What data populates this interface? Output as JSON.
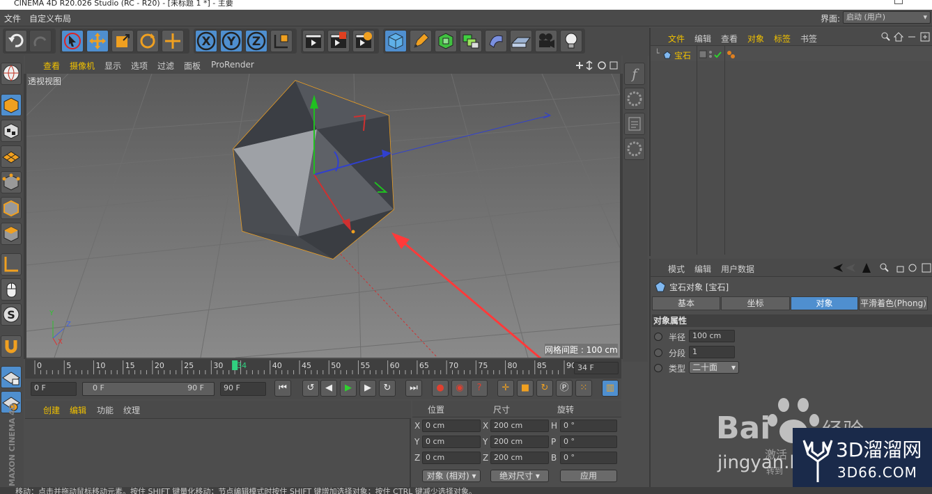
{
  "window": {
    "title": "CINEMA 4D R20.026 Studio (RC - R20) - [未标题 1 *] - 主要"
  },
  "menubar": {
    "items": [
      "文件",
      "自定义布局"
    ],
    "layout_label": "界面:",
    "layout_value": "启动 (用户)"
  },
  "viewport": {
    "menu": [
      "查看",
      "摄像机",
      "显示",
      "选项",
      "过滤",
      "面板",
      "ProRender"
    ],
    "view_name": "透视视图",
    "grid_spacing": "网格间距 : 100 cm",
    "axis_labels": {
      "y": "Y",
      "z": "Z",
      "x": "X"
    }
  },
  "timeline": {
    "ticks": [
      "0",
      "5",
      "10",
      "15",
      "20",
      "25",
      "30",
      "34",
      "40",
      "45",
      "50",
      "55",
      "60",
      "65",
      "70",
      "75",
      "80",
      "85",
      "90"
    ],
    "current_frame": "34 F",
    "start_field": "0 F",
    "range_start": "0 F",
    "range_end": "90 F",
    "end_field": "90 F"
  },
  "material_manager": {
    "menu": [
      "创建",
      "编辑",
      "功能",
      "纹理"
    ]
  },
  "coordinates": {
    "headers": [
      "位置",
      "尺寸",
      "旋转"
    ],
    "rows": [
      {
        "axis": "X",
        "pos": "0 cm",
        "saxis": "X",
        "size": "200 cm",
        "raxis": "H",
        "rot": "0 °"
      },
      {
        "axis": "Y",
        "pos": "0 cm",
        "saxis": "Y",
        "size": "200 cm",
        "raxis": "P",
        "rot": "0 °"
      },
      {
        "axis": "Z",
        "pos": "0 cm",
        "saxis": "Z",
        "size": "200 cm",
        "raxis": "B",
        "rot": "0 °"
      }
    ],
    "mode_object": "对象 (相对)",
    "mode_size": "绝对尺寸",
    "apply": "应用"
  },
  "object_manager": {
    "menu": [
      "文件",
      "编辑",
      "查看",
      "对象",
      "标签",
      "书签"
    ],
    "object_name": "宝石"
  },
  "attributes": {
    "menu": [
      "模式",
      "编辑",
      "用户数据"
    ],
    "title": "宝石对象 [宝石]",
    "tabs": [
      "基本",
      "坐标",
      "对象",
      "平滑着色(Phong)"
    ],
    "section": "对象属性",
    "fields": [
      {
        "label": "半径",
        "value": "100 cm"
      },
      {
        "label": "分段",
        "value": "1"
      },
      {
        "label": "类型",
        "value": "二十面"
      }
    ]
  },
  "statusbar": {
    "text": "移动：点击并拖动鼠标移动元素。按住 SHIFT 键量化移动；节点编辑模式时按住 SHIFT 键增加选择对象；按住 CTRL 键减少选择对象。"
  },
  "side_brand": "MAXON CINEMA 4D",
  "watermarks": {
    "baidu_text": "Bai",
    "baidu_jingyan": "jingyan.b",
    "baidu_extra": "经验",
    "activate": "激活",
    "goto": "转到",
    "site_cn": "3D溜溜网",
    "site_url": "3D66.COM"
  },
  "colors": {
    "accent": "#4f8fcf",
    "active_text": "#f0c000",
    "arrow": "#ff3a3a"
  }
}
